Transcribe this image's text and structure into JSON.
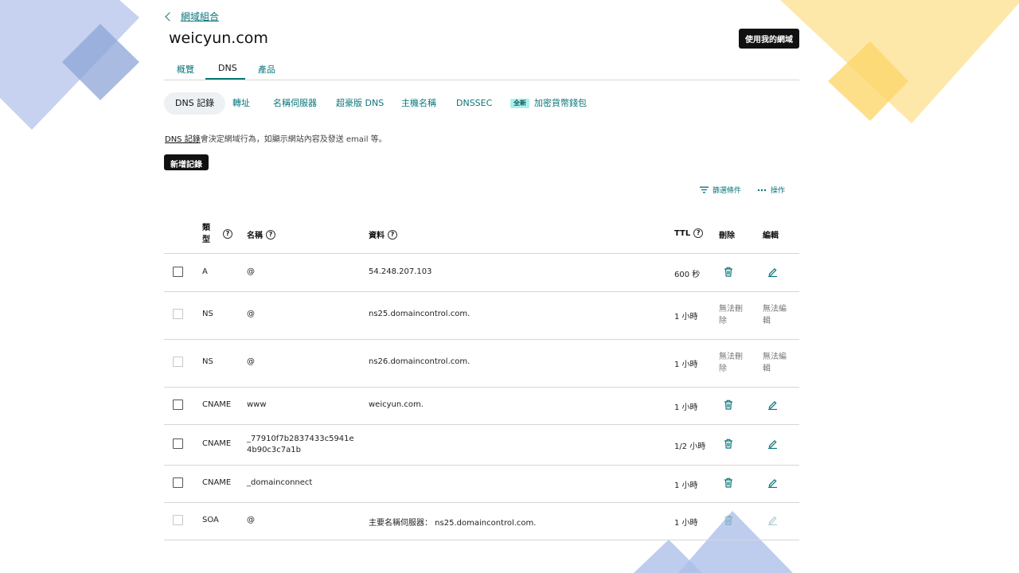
{
  "nav": {
    "back_label": "網域組合"
  },
  "domain": "weicyun.com",
  "use_domain_button": "使用我的網域",
  "tabs": [
    {
      "label": "概覽"
    },
    {
      "label": "DNS"
    },
    {
      "label": "產品"
    }
  ],
  "subnav": [
    {
      "label": "DNS 記錄"
    },
    {
      "label": "轉址"
    },
    {
      "label": "名稱伺服器"
    },
    {
      "label": "超豪版 DNS"
    },
    {
      "label": "主機名稱"
    },
    {
      "label": "DNSSEC"
    },
    {
      "label": "加密貨幣錢包",
      "badge": "全新"
    }
  ],
  "description": {
    "link": "DNS 記錄",
    "text": "會決定網域行為，如顯示網站內容及發送 email 等。"
  },
  "add_record_button": "新增記錄",
  "toolbar": {
    "filter": "篩選條件",
    "actions": "操作"
  },
  "table": {
    "headers": {
      "type": "類型",
      "name": "名稱",
      "data": "資料",
      "ttl": "TTL",
      "delete": "刪除",
      "edit": "編輯"
    },
    "cannot_delete": "無法刪除",
    "cannot_edit": "無法編輯",
    "rows": [
      {
        "type": "A",
        "name": "@",
        "data": "54.248.207.103",
        "ttl": "600 秒",
        "locked": false
      },
      {
        "type": "NS",
        "name": "@",
        "data": "ns25.domaincontrol.com.",
        "ttl": "1 小時",
        "locked": true
      },
      {
        "type": "NS",
        "name": "@",
        "data": "ns26.domaincontrol.com.",
        "ttl": "1 小時",
        "locked": true
      },
      {
        "type": "CNAME",
        "name": "www",
        "data": "weicyun.com.",
        "ttl": "1 小時",
        "locked": false
      },
      {
        "type": "CNAME",
        "name": "_77910f7b2837433c5941e4b90c3c7a1b",
        "data": "",
        "ttl": "1/2 小時",
        "locked": false
      },
      {
        "type": "CNAME",
        "name": "_domainconnect",
        "data": "",
        "ttl": "1 小時",
        "locked": false
      },
      {
        "type": "SOA",
        "name": "@",
        "data": "主要名稱伺服器： ns25.domaincontrol.com.",
        "ttl": "1 小時",
        "locked": false,
        "disabled": true
      }
    ]
  },
  "colors": {
    "accent": "#09757a",
    "blue_deco": "#aebfe8",
    "yellow_deco": "#fde49a"
  }
}
